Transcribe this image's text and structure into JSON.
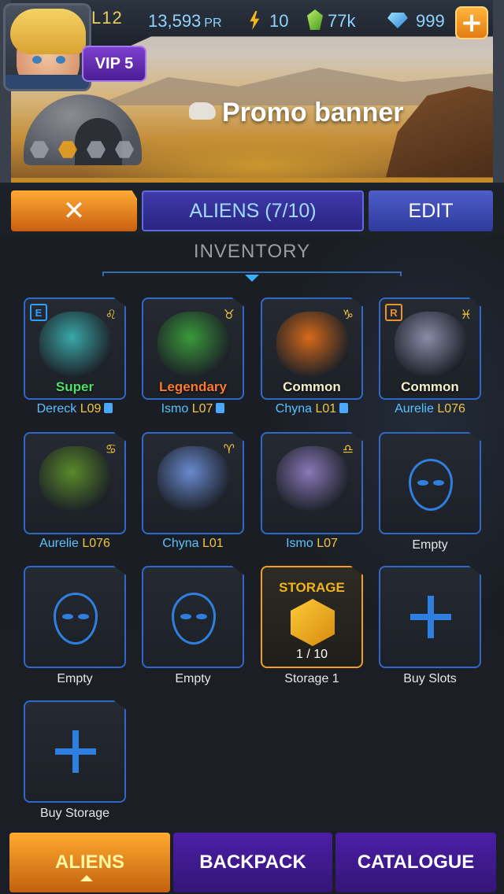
{
  "player": {
    "level": "L12",
    "vip": "VIP 5"
  },
  "resources": {
    "pr_value": "13,593",
    "pr_unit": "PR",
    "energy": "10",
    "crystals": "77k",
    "gems": "999"
  },
  "promo": {
    "title": "Promo banner",
    "pages": 4,
    "active_page": 2
  },
  "tabs": {
    "close": "✕",
    "title": "ALIENS (7/10)",
    "edit": "EDIT"
  },
  "inventory": {
    "heading": "INVENTORY",
    "slots": [
      {
        "kind": "alien",
        "rarity": "Super",
        "rarity_color": "#4de06a",
        "owner": "Dereck",
        "level": "L09",
        "locked": true,
        "badge": "E",
        "badge_color": "#2f9fff",
        "sign": "♌",
        "color": "#3aa8a8"
      },
      {
        "kind": "alien",
        "rarity": "Legendary",
        "rarity_color": "#ff7a2a",
        "owner": "Ismo",
        "level": "L07",
        "locked": true,
        "badge": "",
        "sign": "♉",
        "color": "#3a9a3a"
      },
      {
        "kind": "alien",
        "rarity": "Common",
        "rarity_color": "#f4f0c8",
        "owner": "Chyna",
        "level": "L01",
        "locked": true,
        "badge": "",
        "sign": "♑",
        "color": "#d66a1a"
      },
      {
        "kind": "alien",
        "rarity": "Common",
        "rarity_color": "#f4f0c8",
        "owner": "Aurelie",
        "level": "L076",
        "locked": false,
        "badge": "R",
        "badge_color": "#f0902a",
        "sign": "♓",
        "color": "#8a8ca8"
      },
      {
        "kind": "alien",
        "rarity": "",
        "owner": "Aurelie",
        "level": "L076",
        "locked": false,
        "badge": "",
        "sign": "♋",
        "color": "#5a8a2a"
      },
      {
        "kind": "alien",
        "rarity": "",
        "owner": "Chyna",
        "level": "L01",
        "locked": false,
        "badge": "",
        "sign": "♈",
        "color": "#6a8ad0"
      },
      {
        "kind": "alien",
        "rarity": "",
        "owner": "Ismo",
        "level": "L07",
        "locked": false,
        "badge": "",
        "sign": "♎",
        "color": "#8a78b8"
      },
      {
        "kind": "empty",
        "caption": "Empty"
      },
      {
        "kind": "empty",
        "caption": "Empty"
      },
      {
        "kind": "empty",
        "caption": "Empty"
      },
      {
        "kind": "storage",
        "label": "STORAGE",
        "count": "1 / 10",
        "caption": "Storage 1"
      },
      {
        "kind": "add",
        "caption": "Buy Slots"
      },
      {
        "kind": "add",
        "caption": "Buy Storage"
      }
    ]
  },
  "bottom_nav": {
    "aliens": "ALIENS",
    "backpack": "BACKPACK",
    "catalogue": "CATALOGUE"
  }
}
